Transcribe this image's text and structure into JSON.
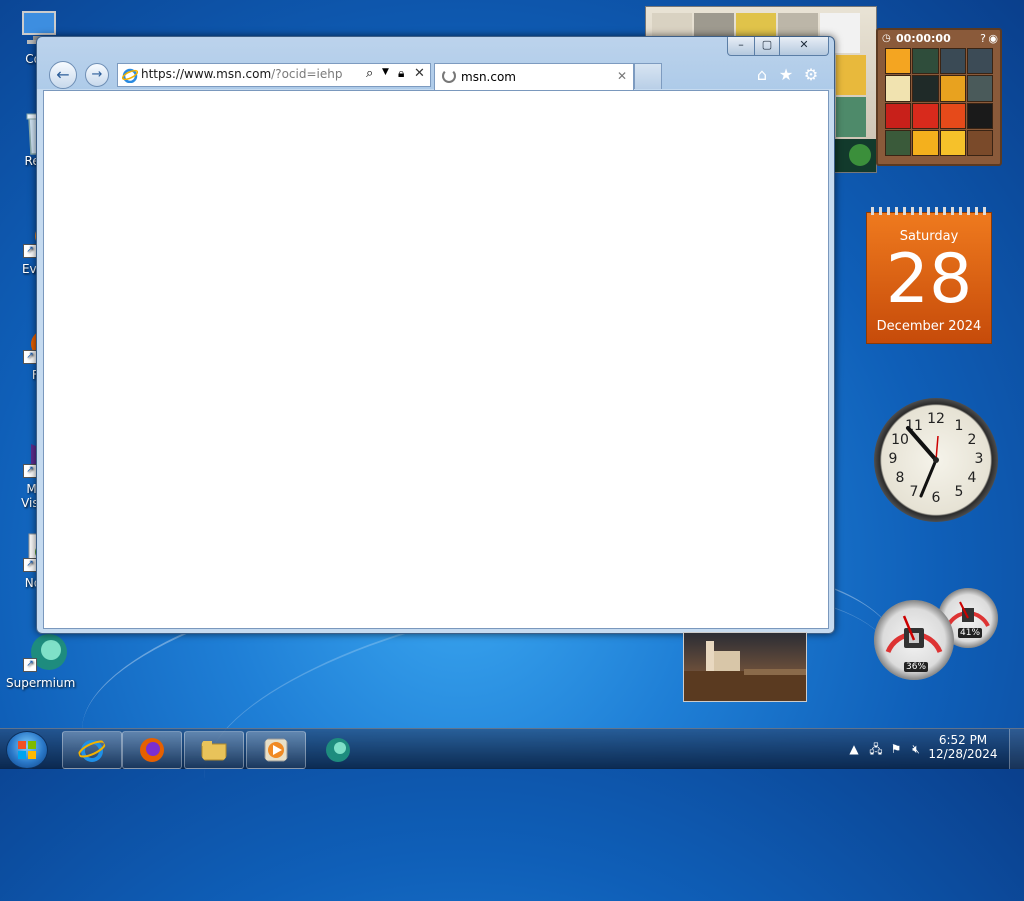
{
  "desktop": {
    "icons": [
      {
        "label": "Computer",
        "visible_label": "Com"
      },
      {
        "label": "Recycle Bin",
        "visible_label": "Recy"
      },
      {
        "label": "Everything",
        "visible_label": "Every"
      },
      {
        "label": "Firefox",
        "visible_label": "Fir"
      },
      {
        "label": "Microsoft Visual",
        "visible_label_1": "Micr",
        "visible_label_2": "Visual"
      },
      {
        "label": "Notepad",
        "visible_label": "Note"
      },
      {
        "label": "Supermium",
        "visible_label": "Supermium"
      }
    ]
  },
  "browser": {
    "address": {
      "url_main": "https://www.msn.com",
      "url_rest": "/?ocid=iehp"
    },
    "tab": {
      "label": "msn.com"
    },
    "controls": {
      "minimize": "–",
      "restore": "▢",
      "close": "✕"
    }
  },
  "gadgets": {
    "puzzle": {
      "timer": "00:00:00"
    },
    "calendar": {
      "day_of_week": "Saturday",
      "day": "28",
      "month_year": "December 2024"
    },
    "clock": {
      "numbers": [
        "12",
        "1",
        "2",
        "3",
        "4",
        "5",
        "6",
        "7",
        "8",
        "9",
        "10",
        "11"
      ]
    },
    "cpu_meter": {
      "cpu": "36%",
      "memory": "41%"
    }
  },
  "taskbar": {
    "time": "6:52 PM",
    "date": "12/28/2024"
  },
  "colors": {
    "desktop_blue": "#1f7fd6",
    "calendar_orange": "#ef7a1e",
    "taskbar": "#0a2346"
  }
}
